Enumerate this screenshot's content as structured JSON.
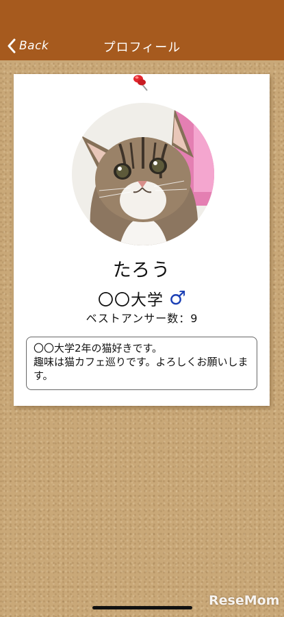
{
  "nav": {
    "back_label": "Back",
    "title": "プロフィール"
  },
  "profile": {
    "name": "たろう",
    "university": "〇〇大学",
    "gender_symbol": "♂",
    "best_answers": "ベストアンサー数：9",
    "bio_line1": "〇〇大学2年の猫好きです。",
    "bio_line2": "趣味は猫カフェ巡りです。よろしくお願いします。"
  },
  "watermark": "ReseMom",
  "colors": {
    "navbar": "#a65a1e",
    "cork": "#c9a878",
    "gender": "#1b3fb5",
    "pin": "#e3262e"
  }
}
